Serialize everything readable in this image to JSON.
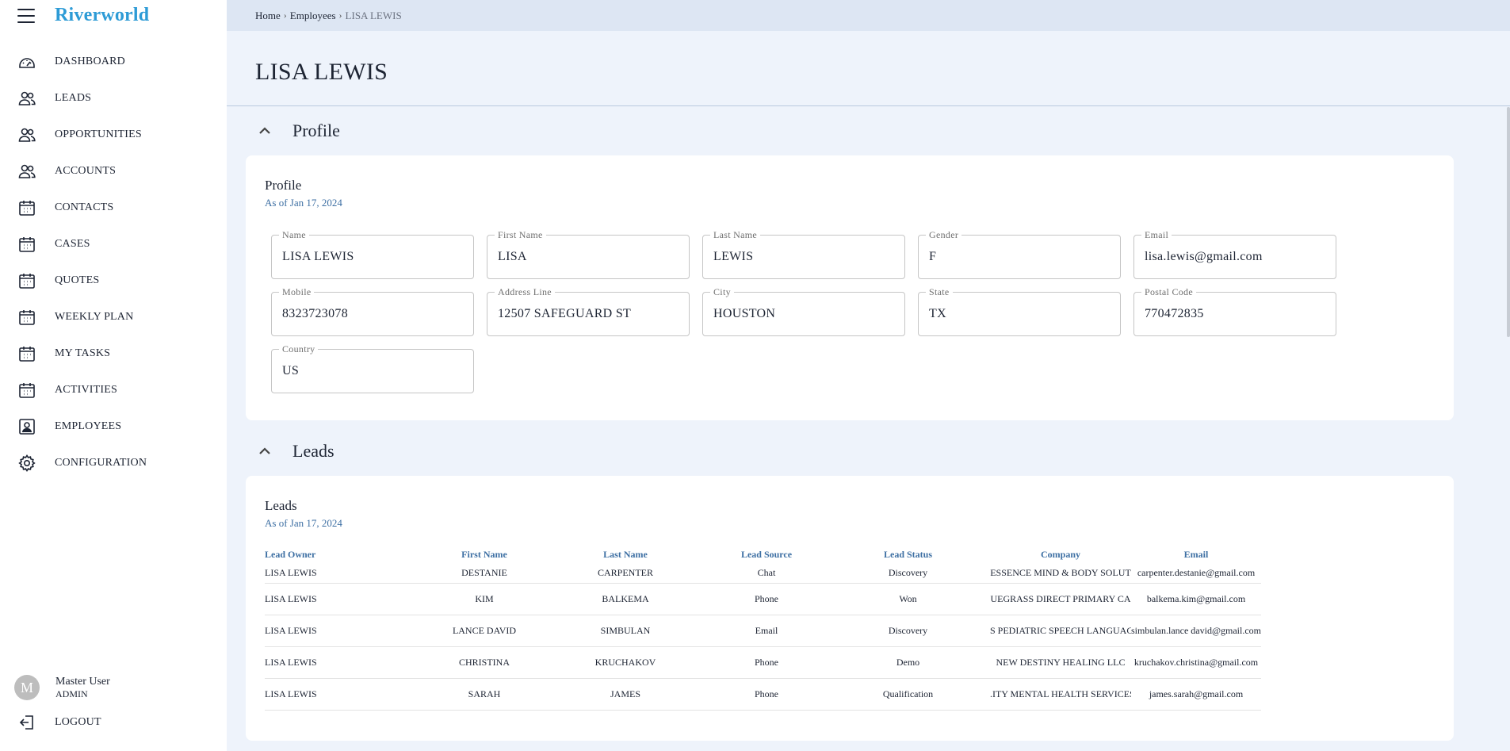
{
  "app": {
    "brand": "Riverworld"
  },
  "sidebar": {
    "items": [
      {
        "label": "DASHBOARD",
        "icon": "dashboard-icon"
      },
      {
        "label": "LEADS",
        "icon": "people-icon"
      },
      {
        "label": "OPPORTUNITIES",
        "icon": "people-icon"
      },
      {
        "label": "ACCOUNTS",
        "icon": "people-icon"
      },
      {
        "label": "CONTACTS",
        "icon": "calendar-icon"
      },
      {
        "label": "CASES",
        "icon": "calendar-icon"
      },
      {
        "label": "QUOTES",
        "icon": "calendar-icon"
      },
      {
        "label": "WEEKLY PLAN",
        "icon": "calendar-icon"
      },
      {
        "label": "MY TASKS",
        "icon": "calendar-icon"
      },
      {
        "label": "ACTIVITIES",
        "icon": "calendar-icon"
      },
      {
        "label": "EMPLOYEES",
        "icon": "badge-icon"
      },
      {
        "label": "CONFIGURATION",
        "icon": "gear-icon"
      }
    ],
    "user": {
      "initial": "M",
      "name": "Master User",
      "role": "ADMIN"
    },
    "logout_label": "LOGOUT"
  },
  "breadcrumb": {
    "home": "Home",
    "employees": "Employees",
    "current": "LISA LEWIS"
  },
  "page": {
    "title": "LISA LEWIS"
  },
  "profile_section": {
    "header": "Profile",
    "card_title": "Profile",
    "as_of": "As of Jan 17, 2024",
    "fields": {
      "name": {
        "label": "Name",
        "value": "LISA LEWIS"
      },
      "first_name": {
        "label": "First Name",
        "value": "LISA"
      },
      "last_name": {
        "label": "Last Name",
        "value": "LEWIS"
      },
      "gender": {
        "label": "Gender",
        "value": "F"
      },
      "email": {
        "label": "Email",
        "value": "lisa.lewis@gmail.com"
      },
      "mobile": {
        "label": "Mobile",
        "value": "8323723078"
      },
      "address": {
        "label": "Address Line",
        "value": "12507 SAFEGUARD ST"
      },
      "city": {
        "label": "City",
        "value": "HOUSTON"
      },
      "state": {
        "label": "State",
        "value": "TX"
      },
      "postal": {
        "label": "Postal Code",
        "value": "770472835"
      },
      "country": {
        "label": "Country",
        "value": "US"
      }
    }
  },
  "leads_section": {
    "header": "Leads",
    "card_title": "Leads",
    "as_of": "As of Jan 17, 2024",
    "columns": [
      "Lead Owner",
      "First Name",
      "Last Name",
      "Lead Source",
      "Lead Status",
      "Company",
      "Email"
    ],
    "rows": [
      [
        "LISA LEWIS",
        "DESTANIE",
        "CARPENTER",
        "Chat",
        "Discovery",
        "ESSENCE MIND & BODY SOLUT",
        "carpenter.destanie@gmail.com"
      ],
      [
        "LISA LEWIS",
        "KIM",
        "BALKEMA",
        "Phone",
        "Won",
        "UEGRASS DIRECT PRIMARY CA",
        "balkema.kim@gmail.com"
      ],
      [
        "LISA LEWIS",
        "LANCE DAVID",
        "SIMBULAN",
        "Email",
        "Discovery",
        "S PEDIATRIC SPEECH LANGUAG",
        "simbulan.lance david@gmail.com"
      ],
      [
        "LISA LEWIS",
        "CHRISTINA",
        "KRUCHAKOV",
        "Phone",
        "Demo",
        "NEW DESTINY HEALING LLC",
        "kruchakov.christina@gmail.com"
      ],
      [
        "LISA LEWIS",
        "SARAH",
        "JAMES",
        "Phone",
        "Qualification",
        ".ITY MENTAL HEALTH SERVICES",
        "james.sarah@gmail.com"
      ]
    ]
  }
}
